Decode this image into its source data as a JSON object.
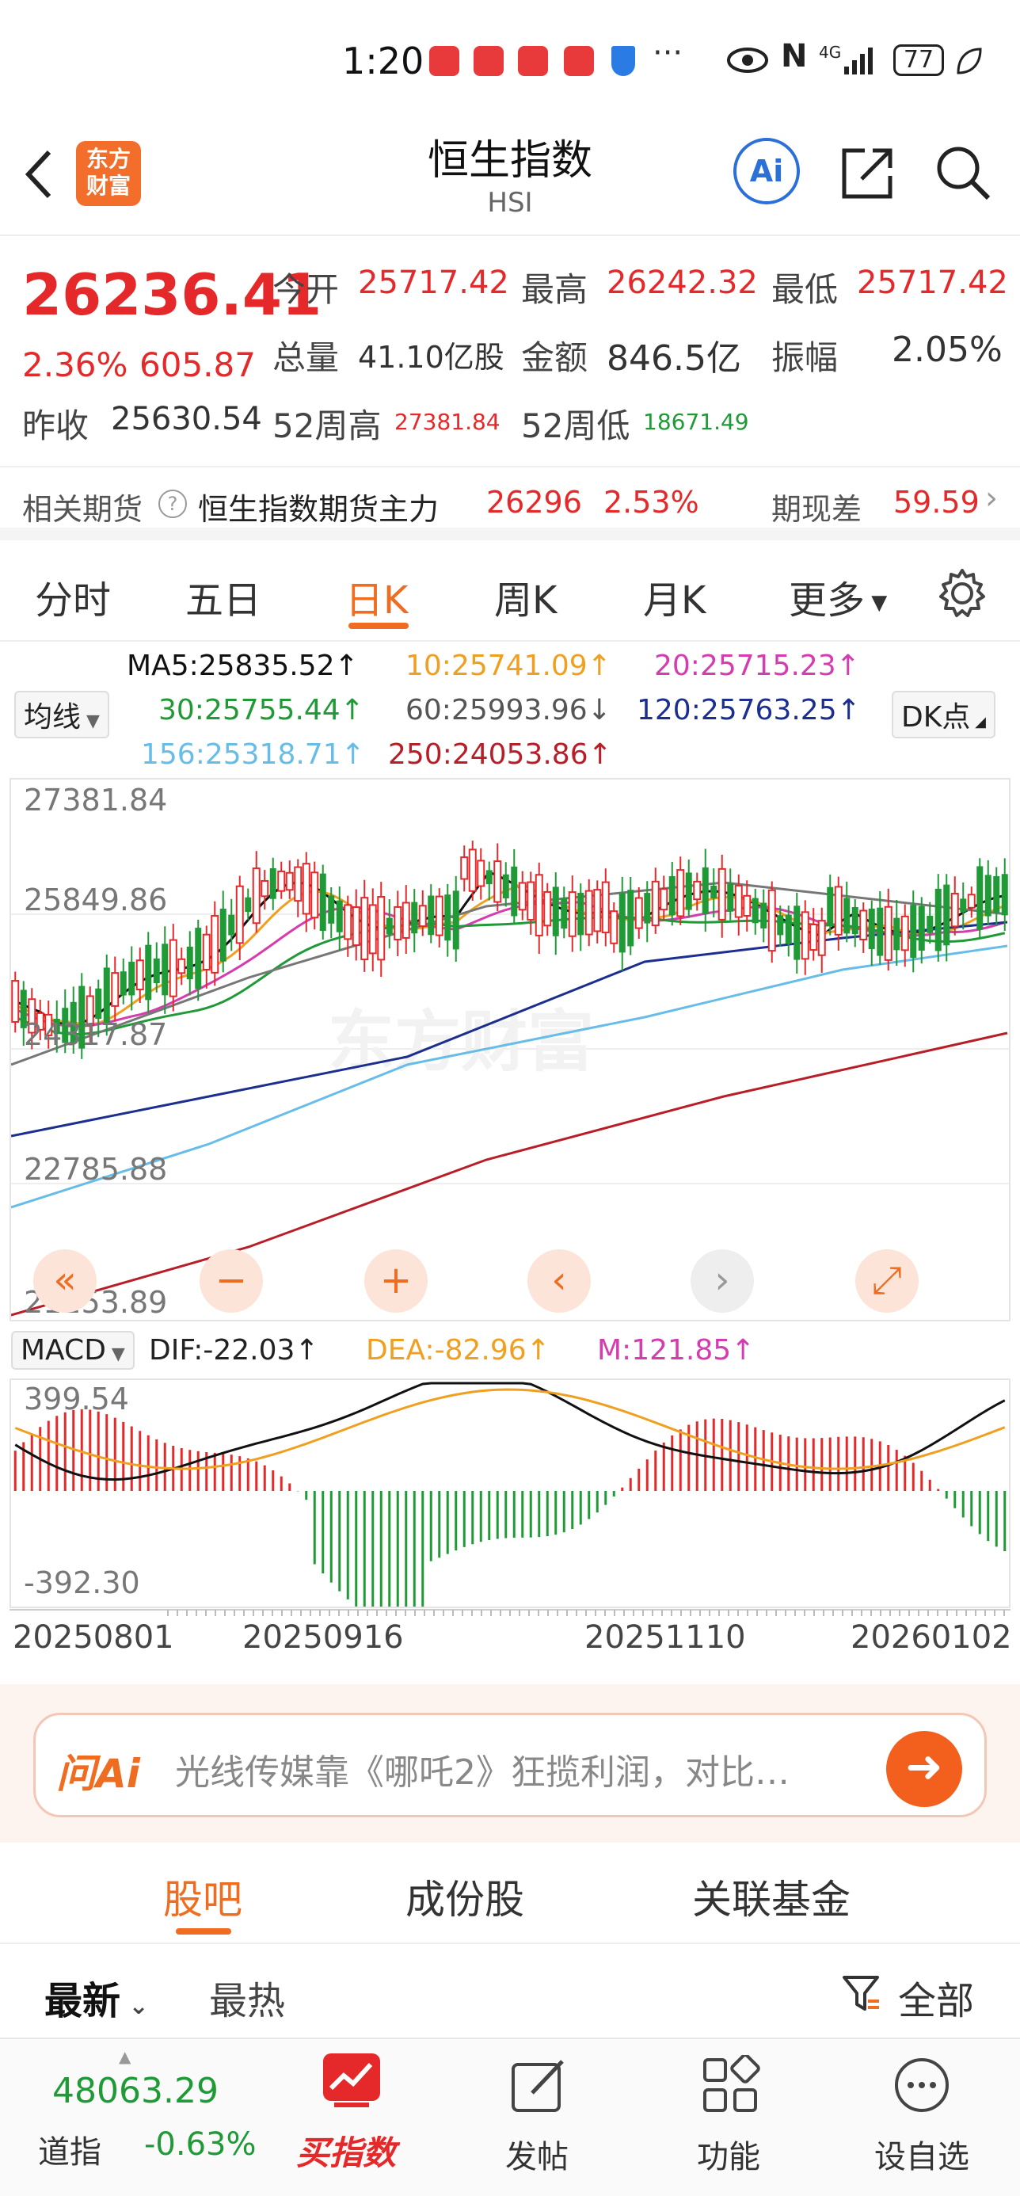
{
  "status_bar": {
    "time": "1:20",
    "network": "4G",
    "battery": "77"
  },
  "header": {
    "back_icon": "chevron-left-icon",
    "logo_text_line1": "东方",
    "logo_text_line2": "财富",
    "title": "恒生指数",
    "subtitle": "HSI",
    "ai_label": "Ai"
  },
  "quote": {
    "price": "26236.41",
    "change_pct": "2.36%",
    "change_abs": "605.87",
    "prev_close_label": "昨收",
    "prev_close": "25630.54",
    "open_label": "今开",
    "open": "25717.42",
    "high_label": "最高",
    "high": "26242.32",
    "low_label": "最低",
    "low": "25717.42",
    "volume_label": "总量",
    "volume": "41.10亿股",
    "amount_label": "金额",
    "amount": "846.5亿",
    "amplitude_label": "振幅",
    "amplitude": "2.05%",
    "wk52_high_label": "52周高",
    "wk52_high": "27381.84",
    "wk52_low_label": "52周低",
    "wk52_low": "18671.49"
  },
  "futures": {
    "label": "相关期货",
    "help_icon": "question-circle-icon",
    "name": "恒生指数期货主力",
    "price": "26296",
    "change_pct": "2.53%",
    "basis_label": "期现差",
    "basis": "59.59"
  },
  "period_tabs": [
    {
      "label": "分时",
      "active": false
    },
    {
      "label": "五日",
      "active": false
    },
    {
      "label": "日K",
      "active": true
    },
    {
      "label": "周K",
      "active": false
    },
    {
      "label": "月K",
      "active": false
    },
    {
      "label": "更多",
      "active": false
    }
  ],
  "ma_legend": {
    "selector": "均线",
    "dk_label": "DK点",
    "ma5": "MA5:25835.52↑",
    "ma10": "10:25741.09↑",
    "ma20": "20:25715.23↑",
    "ma30": "30:25755.44↑",
    "ma60": "60:25993.96↓",
    "ma120": "120:25763.25↑",
    "ma156": "156:25318.71↑",
    "ma250": "250:24053.86↑"
  },
  "colors": {
    "up": "#e5292b",
    "down": "#1f9a36",
    "accent": "#ee6d20",
    "ma5": "#111111",
    "ma10": "#f0a020",
    "ma20": "#d63bb0",
    "ma30": "#1f9a36",
    "ma60": "#777777",
    "ma120": "#1c2f8f",
    "ma156": "#67bde8",
    "ma250": "#b81e28"
  },
  "macd_legend": {
    "selector": "MACD",
    "dif": "DIF:-22.03↑",
    "dea": "DEA:-82.96↑",
    "m": "M:121.85↑"
  },
  "chart_data": {
    "type": "candlestick",
    "y_ticks": [
      "27381.84",
      "25849.86",
      "24317.87",
      "22785.88",
      "21253.89"
    ],
    "ylim": [
      21253.89,
      27381.84
    ],
    "x_ticks": [
      "20250801",
      "20250916",
      "20251110",
      "20260102"
    ],
    "macd_y_ticks": [
      "399.54",
      "-392.30"
    ],
    "macd_ylim": [
      -392.3,
      399.54
    ],
    "watermark": "东方财富"
  },
  "chart_controls": [
    {
      "icon": "double-chevron-left-icon",
      "glyph": "«",
      "enabled": true
    },
    {
      "icon": "zoom-out-icon",
      "glyph": "−",
      "enabled": true
    },
    {
      "icon": "zoom-in-icon",
      "glyph": "+",
      "enabled": true
    },
    {
      "icon": "chevron-left-icon",
      "glyph": "‹",
      "enabled": true
    },
    {
      "icon": "chevron-right-icon",
      "glyph": "›",
      "enabled": false
    },
    {
      "icon": "fullscreen-icon",
      "glyph": "⤢",
      "enabled": true
    }
  ],
  "ask_bar": {
    "brand": "问Ai",
    "text": "光线传媒靠《哪吒2》狂揽利润，对比…"
  },
  "section_tabs": [
    {
      "label": "股吧",
      "active": true
    },
    {
      "label": "成份股",
      "active": false
    },
    {
      "label": "关联基金",
      "active": false
    }
  ],
  "sort": {
    "latest": "最新",
    "hot": "最热",
    "filter": "全部"
  },
  "bottom_nav": {
    "ticker_value": "48063.29",
    "ticker_name": "道指",
    "ticker_change": "-0.63%",
    "buy_label": "买指数",
    "post_label": "发帖",
    "func_label": "功能",
    "watch_label": "设自选"
  }
}
